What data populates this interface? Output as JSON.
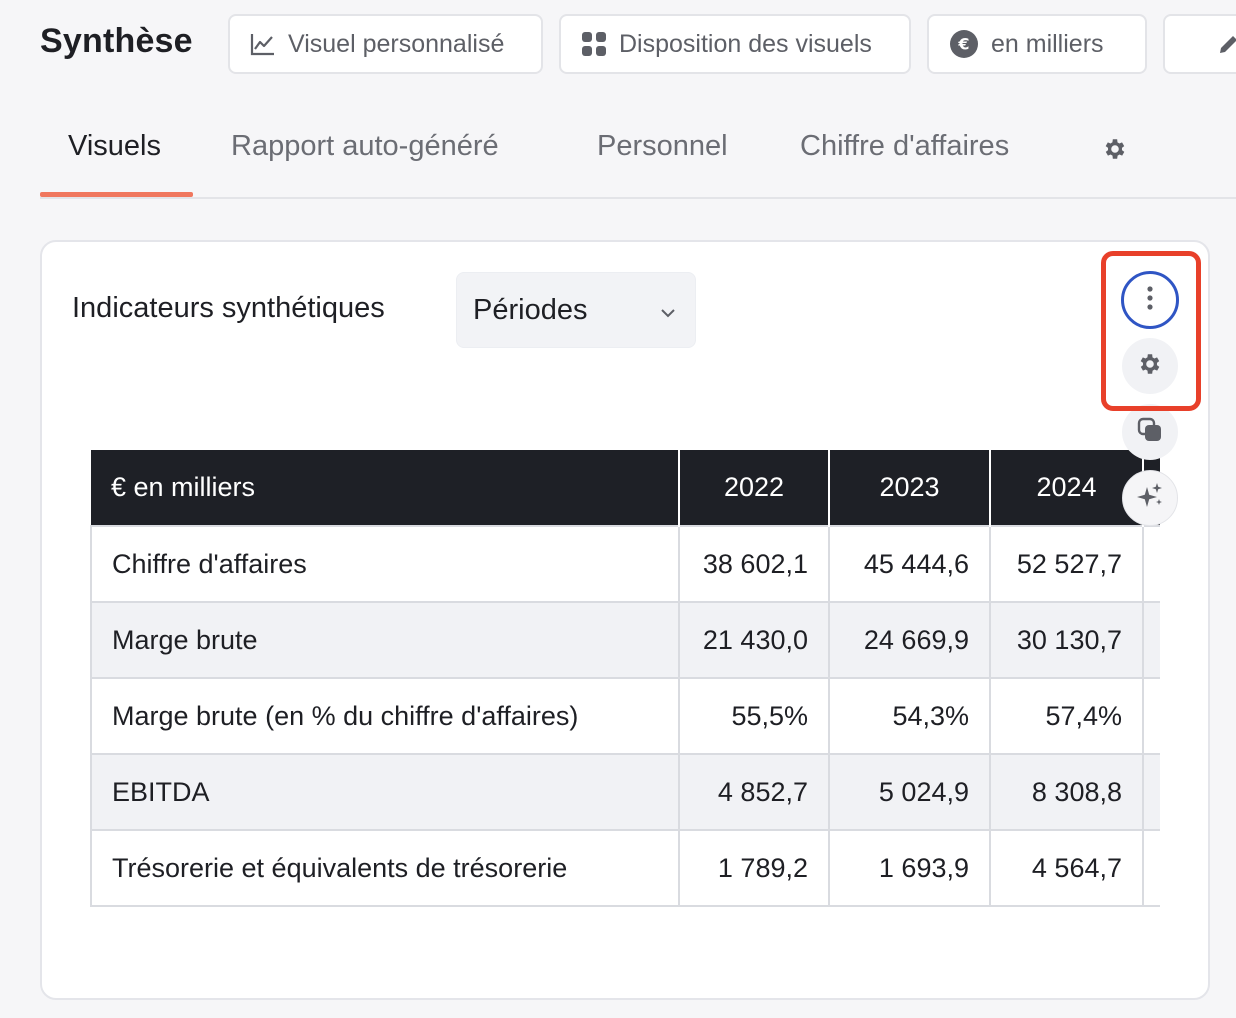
{
  "header": {
    "title": "Synthèse",
    "buttons": {
      "visuel": "Visuel personnalisé",
      "disposition": "Disposition des visuels",
      "milliers": "en milliers"
    }
  },
  "tabs": [
    {
      "label": "Visuels"
    },
    {
      "label": "Rapport auto-généré"
    },
    {
      "label": "Personnel"
    },
    {
      "label": "Chiffre d'affaires"
    }
  ],
  "card": {
    "title": "Indicateurs synthétiques",
    "select_value": "Périodes"
  },
  "table": {
    "header": [
      "€ en milliers",
      "2022",
      "2023",
      "2024"
    ],
    "rows": [
      {
        "label": "Chiffre d'affaires",
        "values": [
          "38 602,1",
          "45 444,6",
          "52 527,7"
        ]
      },
      {
        "label": "Marge brute",
        "values": [
          "21 430,0",
          "24 669,9",
          "30 130,7"
        ]
      },
      {
        "label": "Marge brute (en % du chiffre d'affaires)",
        "values": [
          "55,5%",
          "54,3%",
          "57,4%"
        ]
      },
      {
        "label": "EBITDA",
        "values": [
          "4 852,7",
          "5 024,9",
          "8 308,8"
        ]
      },
      {
        "label": "Trésorerie et équivalents de trésorerie",
        "values": [
          "1 789,2",
          "1 693,9",
          "4 564,7"
        ]
      }
    ]
  },
  "colors": {
    "accent": "#f0775e",
    "table_header_bg": "#1e2026",
    "highlight_red": "#e8402a",
    "focus_blue": "#2f55c4"
  },
  "icons": {
    "visuel": "line-chart-icon",
    "disposition": "grid-icon",
    "milliers": "euro-circle-icon",
    "edit": "pencil-icon",
    "tab_settings": "gear-icon",
    "select": "chevron-down-icon",
    "more": "more-vertical-icon",
    "settings": "gear-icon",
    "copy": "copy-icon",
    "ai": "sparkles-icon"
  }
}
